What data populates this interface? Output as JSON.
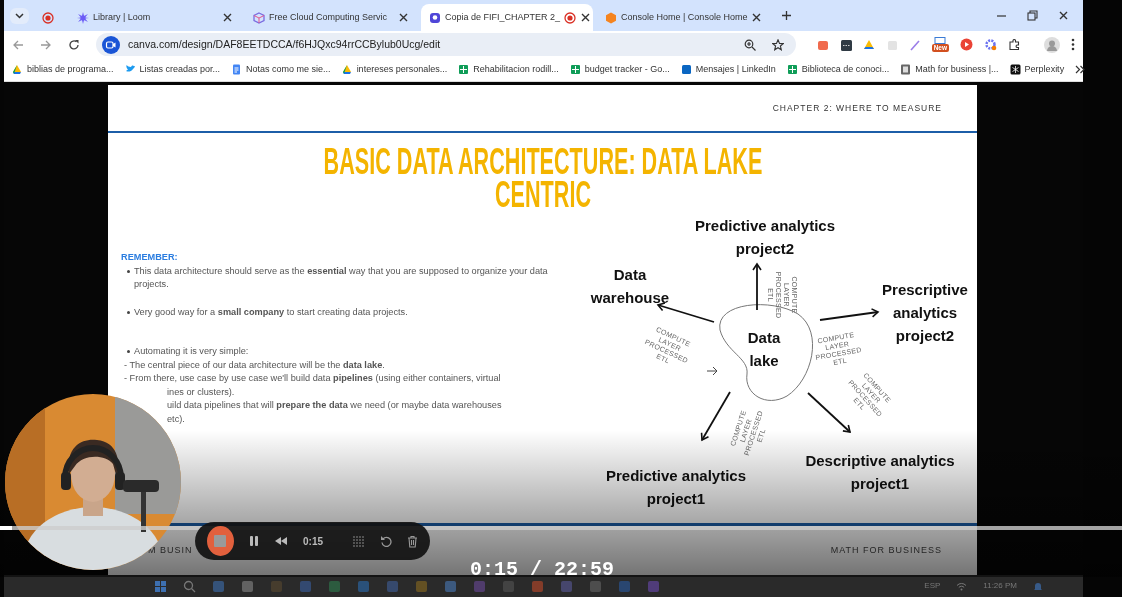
{
  "tabs": [
    {
      "selected": false,
      "recording": true
    },
    {
      "title": "Library | Loom",
      "selected": false,
      "recording": false
    },
    {
      "title": "Free Cloud Computing Servic",
      "selected": false,
      "recording": false
    },
    {
      "title": "Copia de FIFI_CHAPTER 2_",
      "selected": true,
      "recording": true
    },
    {
      "title": "Console Home | Console Home",
      "selected": false,
      "recording": false
    }
  ],
  "address_bar": {
    "url": "canva.com/design/DAF8EETDCCA/f6HJQxc94rrCCBylub0Ucg/edit"
  },
  "extension_badge": "New",
  "bookmarks": [
    "biblias de programa...",
    "Listas creadas por...",
    "Notas como me sie...",
    "intereses personales...",
    "Rehabilitacion rodill...",
    "budget tracker - Go...",
    "Mensajes | LinkedIn",
    "Biblioteca de conoci...",
    "Math for business |...",
    "Perplexity"
  ],
  "slide": {
    "header": "CHAPTER 2: WHERE TO MEASURE",
    "title": "BASIC DATA ARCHITECTURE: DATA LAKE CENTRIC",
    "notes": {
      "heading": "REMEMBER:",
      "lines": [
        {
          "kind": "bullet",
          "text": "This data architecture should serve as the **essential** way that you are supposed to organize your data projects."
        },
        {
          "kind": "bullet",
          "text": "Very good way for a **small company** to start creating data projects."
        },
        {
          "kind": "bullet",
          "text": "Automating it is very simple:"
        },
        {
          "kind": "dash",
          "text": "- The central piece of our data architecture will be the **data lake**."
        },
        {
          "kind": "dash",
          "text": "- From there, use case by use case we'll build data **pipelines** (using either containers, virtual"
        },
        {
          "kind": "cut",
          "text": "ines or clusters)."
        },
        {
          "kind": "cut",
          "text": "uild data pipelines that will **prepare the data** we need (or maybe data warehouses"
        },
        {
          "kind": "cut",
          "text": "etc)."
        }
      ]
    },
    "diagram": {
      "center": "Data lake",
      "nodes": [
        {
          "label": "Predictive analytics project2",
          "edge_label": "COMPUTE LAYER PROCESSED ETL"
        },
        {
          "label": "Data warehouse",
          "edge_label": "COMPUTE LAYER PROCESSED ETL"
        },
        {
          "label": "Prescriptive analytics project2",
          "edge_label": "COMPUTE LAYER PROCESSED ETL"
        },
        {
          "label": "Descriptive analytics project1",
          "edge_label": "COMPUTE LAYER PROCESSED ETL"
        },
        {
          "label": "Predictive analytics project1",
          "edge_label": "COMPUTE LAYER PROCESSED ETL"
        }
      ]
    },
    "footer_left": "M BUSIN",
    "footer_right": "MATH FOR BUSINESS"
  },
  "recorder": {
    "elapsed": "0:15"
  },
  "player": {
    "time": "0:15 / 22:59",
    "progress": {
      "level": 0.011
    }
  },
  "taskbar": {
    "language": "ESP",
    "clock": "11:26 PM"
  }
}
